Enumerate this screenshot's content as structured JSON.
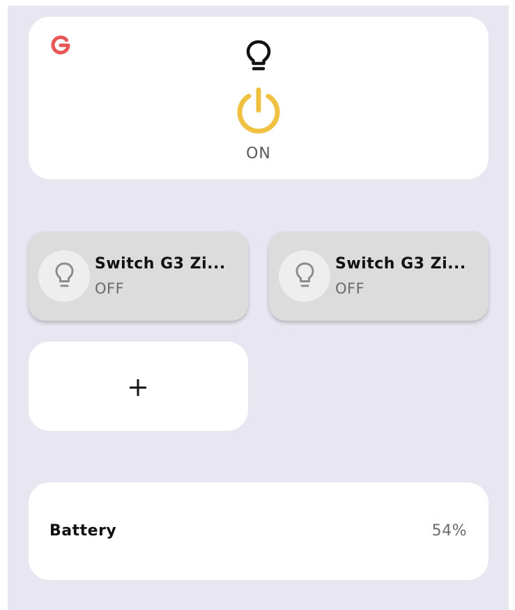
{
  "colors": {
    "background": "#e8e6f0",
    "card": "#ffffff",
    "power_on": "#f0c040",
    "brand_logo": "#e85555",
    "tile_off": "#dcdcdc"
  },
  "main_light": {
    "icon": "lightbulb-icon",
    "power_icon": "power-icon",
    "state": "ON",
    "logo_icon": "brand-logo-icon"
  },
  "switches": [
    {
      "name": "Switch G3 Zi...",
      "state": "OFF",
      "icon": "lightbulb-icon"
    },
    {
      "name": "Switch G3 Zi...",
      "state": "OFF",
      "icon": "lightbulb-icon"
    }
  ],
  "add_button": {
    "icon": "plus-icon"
  },
  "battery": {
    "label": "Battery",
    "value": "54%"
  }
}
